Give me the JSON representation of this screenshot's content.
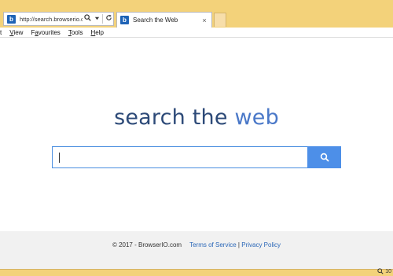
{
  "browser": {
    "address_url": "http://search.browserio.c...",
    "tab_title": "Search the Web",
    "tab_close": "×",
    "favicon_letter": "b",
    "zoom_text": "10"
  },
  "menu": {
    "items": [
      {
        "label": "t"
      },
      {
        "label": "View",
        "underline": "V"
      },
      {
        "label": "Favourites",
        "underline": "a"
      },
      {
        "label": "Tools",
        "underline": "T"
      },
      {
        "label": "Help",
        "underline": "H"
      }
    ]
  },
  "page": {
    "logo_main": "search the ",
    "logo_accent": "web",
    "search_placeholder": "",
    "colors": {
      "accent": "#4d8fe8",
      "logo_dark": "#2d4a78",
      "logo_light": "#4a78c8",
      "chrome": "#f3d27a"
    }
  },
  "footer": {
    "copyright": "© 2017 - BrowserIO.com",
    "terms": "Terms of Service",
    "separator": "|",
    "privacy": "Privacy Policy"
  },
  "icons": {
    "search": "search-icon",
    "refresh": "refresh-icon",
    "close": "close-icon",
    "zoom": "zoom-icon"
  }
}
